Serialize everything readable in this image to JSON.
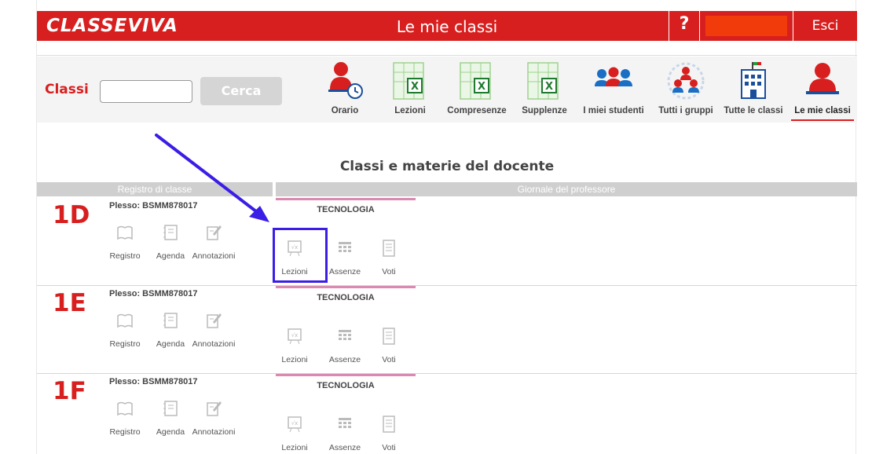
{
  "header": {
    "logo": "CLASSEVIVA",
    "title": "Le mie classi",
    "help": "?",
    "logout": "Esci"
  },
  "search": {
    "label": "Classi",
    "input_value": "",
    "button": "Cerca"
  },
  "nav": [
    {
      "label": "Orario",
      "icon": "clock-person-icon"
    },
    {
      "label": "Lezioni",
      "icon": "spreadsheet-icon"
    },
    {
      "label": "Compresenze",
      "icon": "spreadsheet-icon"
    },
    {
      "label": "Supplenze",
      "icon": "spreadsheet-icon"
    },
    {
      "label": "I miei studenti",
      "icon": "students-icon"
    },
    {
      "label": "Tutti i gruppi",
      "icon": "groups-icon"
    },
    {
      "label": "Tutte le classi",
      "icon": "building-icon"
    },
    {
      "label": "Le mie classi",
      "icon": "teacher-icon",
      "active": true
    }
  ],
  "section_title": "Classi e materie del docente",
  "columns": {
    "left": "Registro di classe",
    "right": "Giornale del professore"
  },
  "classes": [
    {
      "code": "1D",
      "plesso": "Plesso: BSMM878017",
      "subject": "TECNOLOGIA"
    },
    {
      "code": "1E",
      "plesso": "Plesso: BSMM878017",
      "subject": "TECNOLOGIA"
    },
    {
      "code": "1F",
      "plesso": "Plesso: BSMM878017",
      "subject": "TECNOLOGIA"
    }
  ],
  "class_actions": [
    "Registro",
    "Agenda",
    "Annotazioni"
  ],
  "teacher_actions": [
    "Lezioni",
    "Assenze",
    "Voti"
  ],
  "colors": {
    "brand_red": "#d81f1f",
    "highlight_blue": "#3a1ee6",
    "subject_pink": "#d98ab1"
  }
}
